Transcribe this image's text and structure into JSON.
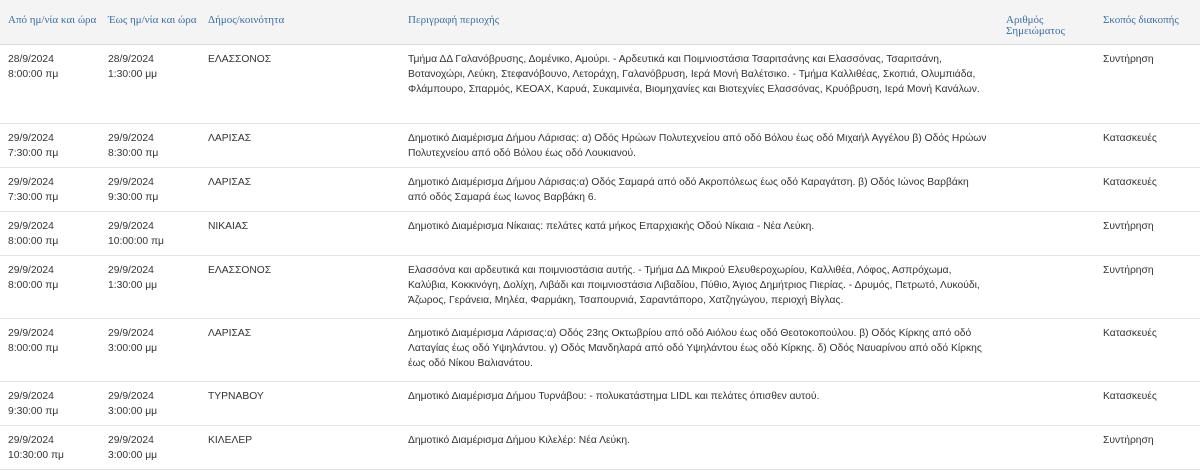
{
  "headers": {
    "from": "Από ημ/νία και ώρα",
    "to": "Έως ημ/νία και ώρα",
    "municipality": "Δήμος/κοινότητα",
    "description": "Περιγραφή περιοχής",
    "mark_number_line1": "Αριθμός",
    "mark_number_line2": "Σημειώματος",
    "purpose": "Σκοπός διακοπής"
  },
  "rows": [
    {
      "from_date": "28/9/2024",
      "from_time": "8:00:00 πμ",
      "to_date": "28/9/2024",
      "to_time": "1:30:00 μμ",
      "municipality": "ΕΛΑΣΣΟΝΟΣ",
      "description": "Τμήμα ΔΔ Γαλανόβρυσης, Δομένικο, Αμούρι. - Αρδευτικά και Ποιμνιοστάσια Τσαριτσάνης και Ελασσόνας, Τσαριτσάνη, Βοτανοχώρι, Λεύκη, Στεφανόβουνο, Λετοράχη, Γαλανόβρυση, Ιερά Μονή Βαλέτσικο. - Τμήμα Καλλιθέας, Σκοπιά, Ολυμπιάδα, Φλάμπουρο, Σπαρμός, ΚΕΟΑΧ, Καρυά, Συκαμινέα, Βιομηχανίες και Βιοτεχνίες Ελασσόνας, Κρυόβρυση, Ιερά Μονή Κανάλων.",
      "mark_number": "",
      "purpose": "Συντήρηση"
    },
    {
      "from_date": "29/9/2024",
      "from_time": "7:30:00 πμ",
      "to_date": "29/9/2024",
      "to_time": "8:30:00 πμ",
      "municipality": "ΛΑΡΙΣΑΣ",
      "description": "Δημοτικό Διαμέρισμα Δήμου Λάρισας: α) Οδός Ηρώων Πολυτεχνείου από οδό Βόλου έως οδό Μιχαήλ Αγγέλου β) Οδός Ηρώων Πολυτεχνείου από οδό Βόλου έως οδό Λουκιανού.",
      "mark_number": "",
      "purpose": "Κατασκευές"
    },
    {
      "from_date": "29/9/2024",
      "from_time": "7:30:00 πμ",
      "to_date": "29/9/2024",
      "to_time": "9:30:00 πμ",
      "municipality": "ΛΑΡΙΣΑΣ",
      "description": "Δημοτικό Διαμέρισμα Δήμου Λάρισας:α) Οδός Σαμαρά από οδό Ακροπόλεως έως οδό Καραγάτση. β) Οδός Ιώνος Βαρβάκη από οδός Σαμαρά έως Ιωνος Βαρβάκη 6.",
      "mark_number": "",
      "purpose": "Κατασκευές"
    },
    {
      "from_date": "29/9/2024",
      "from_time": "8:00:00 πμ",
      "to_date": "29/9/2024",
      "to_time": "10:00:00 πμ",
      "municipality": "ΝΙΚΑΙΑΣ",
      "description": "Δημοτικό Διαμέρισμα Νίκαιας: πελάτες κατά μήκος Επαρχιακής Οδού Νίκαια - Νέα Λεύκη.",
      "mark_number": "",
      "purpose": "Συντήρηση"
    },
    {
      "from_date": "29/9/2024",
      "from_time": "8:00:00 πμ",
      "to_date": "29/9/2024",
      "to_time": "1:30:00 μμ",
      "municipality": "ΕΛΑΣΣΟΝΟΣ",
      "description": "Ελασσόνα και αρδευτικά και ποιμνιοστάσια αυτής. - Τμήμα ΔΔ Μικρού Ελευθεροχωρίου, Καλλιθέα, Λόφος, Ασπρόχωμα, Καλύβια, Κοκκινόγη, Δολίχη, Λιβάδι και ποιμνιοστάσια Λιβαδίου, Πύθιο, Άγιος Δημήτριος Πιερίας. - Δρυμός, Πετρωτό, Λυκούδι, Άζωρος, Γεράνεια, Μηλέα, Φαρμάκη, Τσαπουρνιά, Σαραντάπορο, Χατζηγώγου, περιοχή Βίγλας.",
      "mark_number": "",
      "purpose": "Συντήρηση"
    },
    {
      "from_date": "29/9/2024",
      "from_time": "8:00:00 πμ",
      "to_date": "29/9/2024",
      "to_time": "3:00:00 μμ",
      "municipality": "ΛΑΡΙΣΑΣ",
      "description": "Δημοτικό Διαμέρισμα Λάρισας:α) Οδός 23ης Οκτωβρίου από οδό Αιόλου έως οδό Θεοτοκοπούλου. β) Οδός Κίρκης από οδό Λαταγίας έως οδό Υψηλάντου. γ) Οδός Μανδηλαρά από οδό Υψηλάντου έως οδό Κίρκης. δ) Οδός Ναυαρίνου από οδό Κίρκης έως οδό Νίκου Βαλιανάτου.",
      "mark_number": "",
      "purpose": "Κατασκευές"
    },
    {
      "from_date": "29/9/2024",
      "from_time": "9:30:00 πμ",
      "to_date": "29/9/2024",
      "to_time": "3:00:00 μμ",
      "municipality": "ΤΥΡΝΑΒΟΥ",
      "description": "Δημοτικό Διαμέρισμα Δήμου Τυρνάβου: - πολυκατάστημα LIDL και πελάτες όπισθεν αυτού.",
      "mark_number": "",
      "purpose": "Κατασκευές"
    },
    {
      "from_date": "29/9/2024",
      "from_time": "10:30:00 πμ",
      "to_date": "29/9/2024",
      "to_time": "3:00:00 μμ",
      "municipality": "ΚΙΛΕΛΕΡ",
      "description": "Δημοτικό Διαμέρισμα Δήμου Κιλελέρ: Νέα Λεύκη.",
      "mark_number": "",
      "purpose": "Συντήρηση"
    }
  ]
}
